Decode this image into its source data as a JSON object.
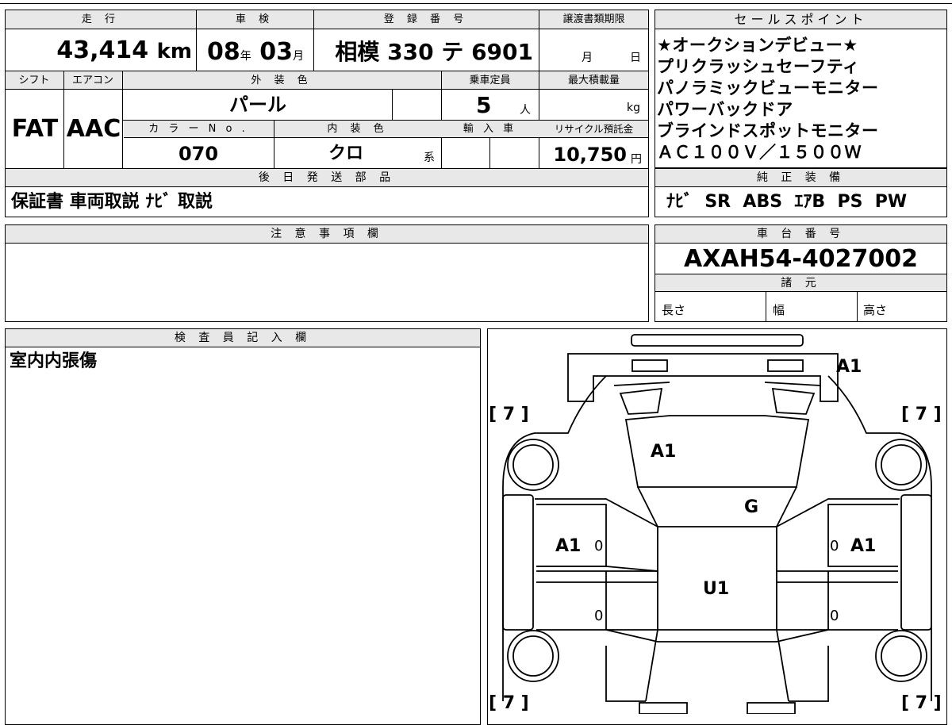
{
  "headers": {
    "mileage": "走 行",
    "inspection": "車 検",
    "registration": "登 録 番 号",
    "transfer_deadline": "譲渡書類期限",
    "sales_points": "セールスポイント",
    "shift": "シフト",
    "aircon": "エアコン",
    "exterior_color": "外 装 色",
    "capacity": "乗車定員",
    "max_load": "最大積載量",
    "color_no": "カ ラ ー N o .",
    "interior_color": "内 装 色",
    "import": "輸 入 車",
    "recycle": "リサイクル預託金",
    "later_parts": "後 日 発 送 部 品",
    "genuine_equipment": "純 正 装 備",
    "notes": "注 意 事 項 欄",
    "chassis_no": "車 台 番 号",
    "specs": "諸 元",
    "inspector": "検 査 員 記 入 欄"
  },
  "vehicle": {
    "mileage_value": "43,414",
    "mileage_unit": "km",
    "inspection_year": "08",
    "inspection_year_unit": "年",
    "inspection_month": "03",
    "inspection_month_unit": "月",
    "registration_number": "相模 330 テ 6901",
    "deadline_month_unit": "月",
    "deadline_day_unit": "日",
    "shift": "FAT",
    "aircon": "AAC",
    "exterior_color": "パール",
    "capacity": "5",
    "capacity_unit": "人",
    "max_load_unit": "kg",
    "color_no": "070",
    "interior_color": "クロ",
    "interior_suffix": "系",
    "recycle_value": "10,750",
    "recycle_unit": "円",
    "later_parts": "保証書 車両取説 ﾅﾋﾞ 取説",
    "chassis_no": "AXAH54-4027002",
    "spec_length": "長さ",
    "spec_width": "幅",
    "spec_height": "高さ"
  },
  "sales_points": [
    "★オークションデビュー★",
    "プリクラッシュセーフティ",
    "パノラミックビューモニター",
    "パワーバックドア",
    "ブラインドスポットモニター",
    "ＡＣ１００Ｖ／１５００Ｗ"
  ],
  "genuine_equipment": "ﾅﾋﾞ  SR  ABS  ｴｱB  PS  PW",
  "inspector_notes": "室内内張傷",
  "diagram": {
    "marks": {
      "rear": "A1",
      "roof": "A1",
      "hood": "G",
      "left_door": "A1",
      "right_door": "A1",
      "floor": "U1"
    },
    "tire_tread": "[ 7 ]",
    "zero": "0"
  }
}
